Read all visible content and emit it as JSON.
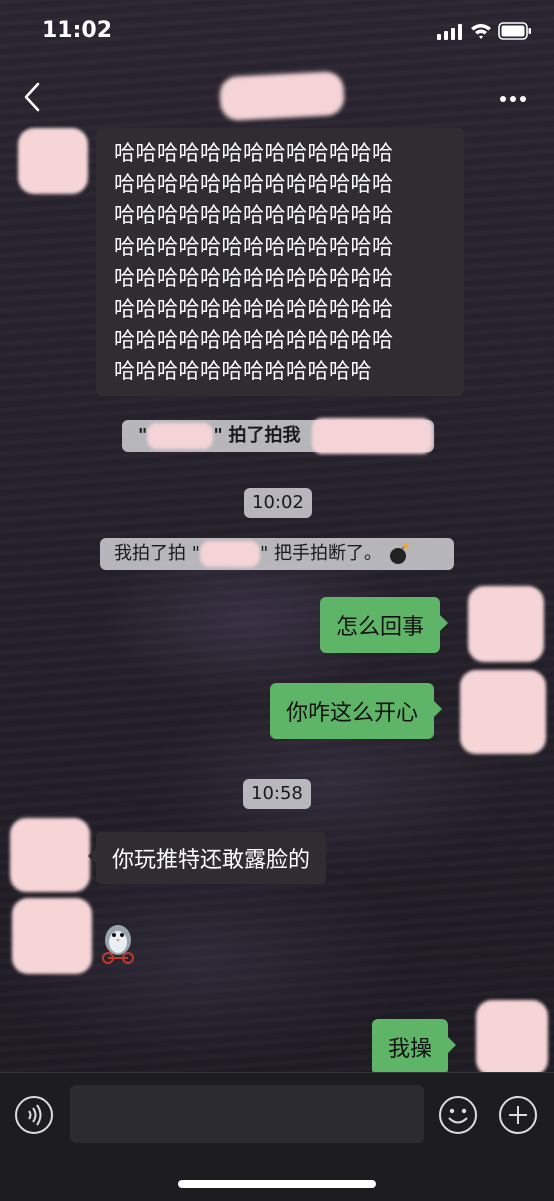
{
  "status": {
    "time": "11:02"
  },
  "messages": {
    "haha_lines": [
      "哈哈哈哈哈哈哈哈哈哈哈哈哈",
      "哈哈哈哈哈哈哈哈哈哈哈哈哈",
      "哈哈哈哈哈哈哈哈哈哈哈哈哈",
      "哈哈哈哈哈哈哈哈哈哈哈哈哈",
      "哈哈哈哈哈哈哈哈哈哈哈哈哈",
      "哈哈哈哈哈哈哈哈哈哈哈哈哈",
      "哈哈哈哈哈哈哈哈哈哈哈哈哈",
      "哈哈哈哈哈哈哈哈哈哈哈哈"
    ],
    "pat1": {
      "quote_open": "\"",
      "quote_close": "\"",
      "text": "拍了拍我"
    },
    "timestamp1": "10:02",
    "pat2": {
      "prefix": "我拍了拍 \"",
      "suffix": "\" 把手拍断了。",
      "icon": "bomb-emoji"
    },
    "out1": "怎么回事",
    "out2": "你咋这么开心",
    "timestamp2": "10:58",
    "in1": "你玩推特还敢露脸的",
    "sticker": "penguin-bike-sticker",
    "out3": "我操"
  },
  "colors": {
    "outgoing_bubble": "#5fb567",
    "incoming_bubble": "#2f2d30",
    "redaction": "#f4d4d6"
  }
}
